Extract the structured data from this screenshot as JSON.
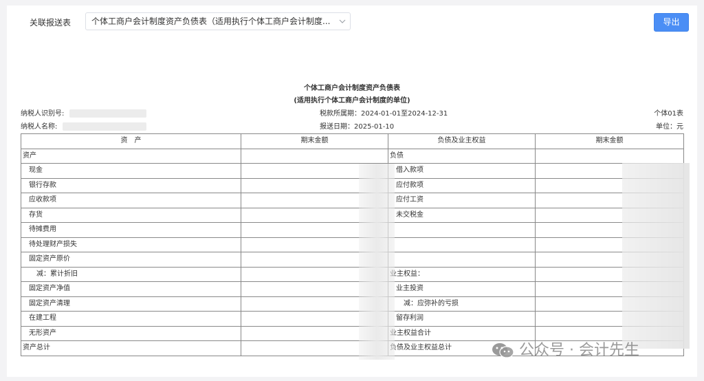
{
  "filter": {
    "label": "关联报送表",
    "selected": "个体工商户会计制度资产负债表（适用执行个体工商户会计制度..."
  },
  "toolbar": {
    "export_label": "导出"
  },
  "report": {
    "title": "个体工商户会计制度资产负债表",
    "subtitle": "(适用执行个体工商户会计制度的单位)",
    "taxpayer_id_label": "纳税人识别号:",
    "taxpayer_name_label": "纳税人名称:",
    "period": "税款所属期：2024-01-01至2024-12-31",
    "submit_date": "报送日期：2025-01-10",
    "form_no": "个体01表",
    "unit": "单位：元"
  },
  "table": {
    "headers": [
      "资　产",
      "期末金额",
      "负债及业主权益",
      "期末金额"
    ],
    "rows": [
      {
        "left": "资产",
        "left_indent": 0,
        "right": "负债",
        "right_indent": 0
      },
      {
        "left": "现金",
        "left_indent": 1,
        "right": "借入款项",
        "right_indent": 1
      },
      {
        "left": "银行存款",
        "left_indent": 1,
        "right": "应付款项",
        "right_indent": 1
      },
      {
        "left": "应收款项",
        "left_indent": 1,
        "right": "应付工资",
        "right_indent": 1
      },
      {
        "left": "存货",
        "left_indent": 1,
        "right": "未交税金",
        "right_indent": 1
      },
      {
        "left": "待摊费用",
        "left_indent": 1,
        "right": "",
        "right_indent": 0
      },
      {
        "left": "待处理财产损失",
        "left_indent": 1,
        "right": "",
        "right_indent": 0
      },
      {
        "left": "固定资产原价",
        "left_indent": 1,
        "right": "",
        "right_indent": 0
      },
      {
        "left": "减：累计折旧",
        "left_indent": 2,
        "right": "业主权益：",
        "right_indent": 0
      },
      {
        "left": "固定资产净值",
        "left_indent": 1,
        "right": "业主投资",
        "right_indent": 1
      },
      {
        "left": "固定资产清理",
        "left_indent": 1,
        "right": "减：应弥补的亏损",
        "right_indent": 2
      },
      {
        "left": "在建工程",
        "left_indent": 1,
        "right": "留存利润",
        "right_indent": 1
      },
      {
        "left": "无形资产",
        "left_indent": 1,
        "right": "业主权益合计",
        "right_indent": 0
      },
      {
        "left": "资产总计",
        "left_indent": 0,
        "right": "负债及业主权益总计",
        "right_indent": 0
      }
    ]
  },
  "watermark": {
    "text": "公众号 · 会计先生",
    "icon": "wechat-icon"
  }
}
